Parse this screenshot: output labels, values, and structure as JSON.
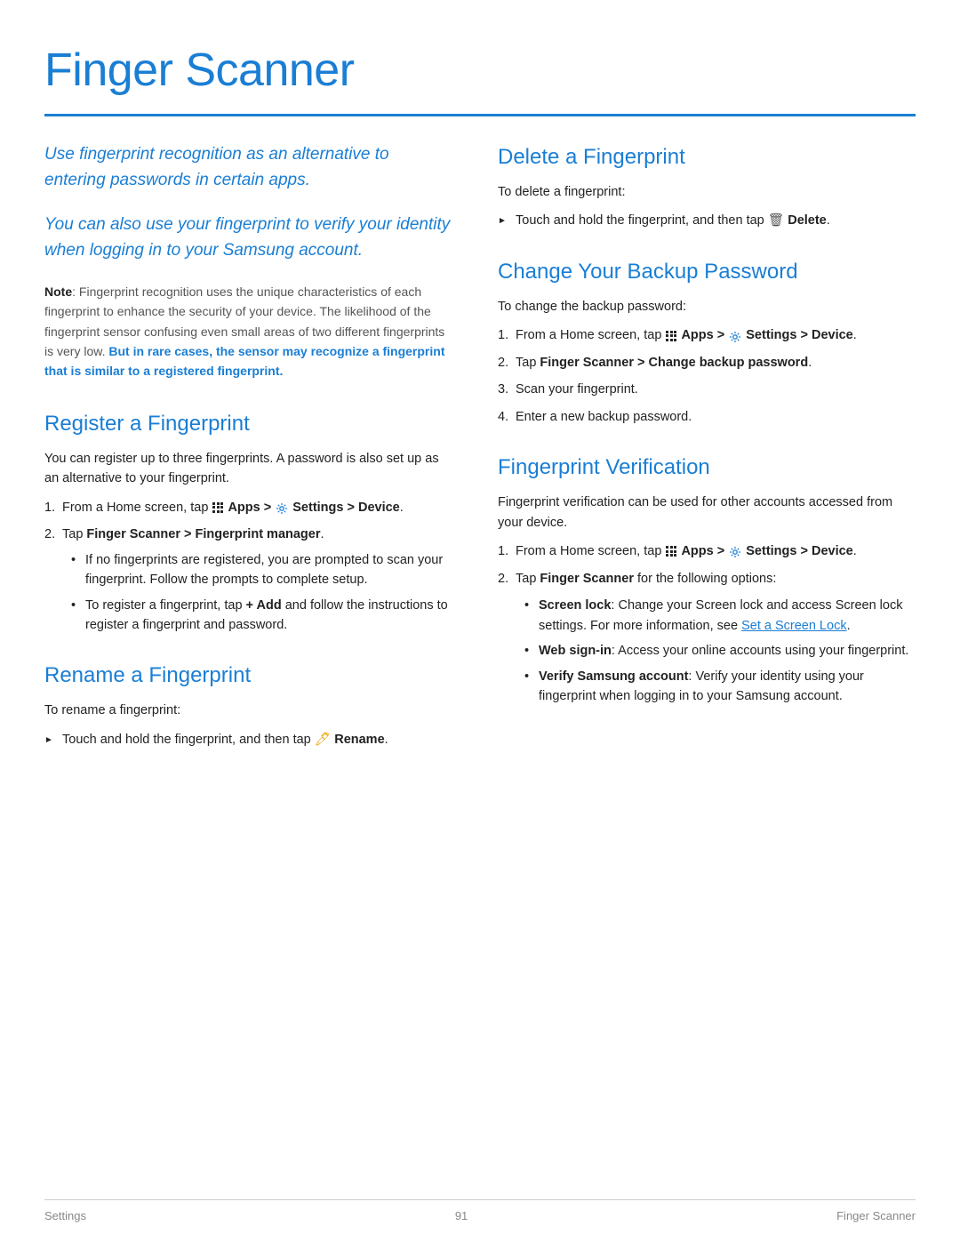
{
  "page": {
    "title": "Finger Scanner",
    "footer": {
      "left": "Settings",
      "center": "91",
      "right": "Finger Scanner"
    }
  },
  "intro": {
    "paragraph1": "Use fingerprint recognition as an alternative to entering passwords in certain apps.",
    "paragraph2": "You can also use your fingerprint to verify your identity when logging in to your Samsung account.",
    "note_label": "Note",
    "note_text": ": Fingerprint recognition uses the unique characteristics of each fingerprint to enhance the security of your device. The likelihood of the fingerprint sensor confusing even small areas of two different fingerprints is very low. ",
    "note_bold_blue": "But in rare cases, the sensor may recognize a fingerprint that is similar to a registered fingerprint."
  },
  "sections": {
    "register": {
      "title": "Register a Fingerprint",
      "intro": "You can register up to three fingerprints. A password is also set up as an alternative to your fingerprint.",
      "steps": [
        {
          "num": "1.",
          "text_parts": [
            "From a Home screen, tap ",
            "Apps > ",
            "Settings > Device",
            "."
          ]
        },
        {
          "num": "2.",
          "text_parts": [
            "Tap ",
            "Finger Scanner > Fingerprint manager",
            "."
          ]
        }
      ],
      "sub_bullets": [
        "If no fingerprints are registered, you are prompted to scan your fingerprint. Follow the prompts to complete setup.",
        "To register a fingerprint, tap  Add and follow the instructions to register a fingerprint and password."
      ]
    },
    "rename": {
      "title": "Rename a Fingerprint",
      "intro": "To rename a fingerprint:",
      "bullet": "Touch and hold the fingerprint, and then tap  Rename."
    },
    "delete": {
      "title": "Delete a Fingerprint",
      "intro": "To delete a fingerprint:",
      "bullet": "Touch and hold the fingerprint, and then tap  Delete."
    },
    "change_backup": {
      "title": "Change Your Backup Password",
      "intro": "To change the backup password:",
      "steps": [
        {
          "num": "1.",
          "text_parts": [
            "From a Home screen, tap ",
            "Apps > ",
            "Settings > Device",
            "."
          ]
        },
        {
          "num": "2.",
          "text_parts": [
            "Tap ",
            "Finger Scanner > Change backup password",
            "."
          ]
        },
        {
          "num": "3.",
          "text_parts": [
            "Scan your fingerprint."
          ]
        },
        {
          "num": "4.",
          "text_parts": [
            "Enter a new backup password."
          ]
        }
      ]
    },
    "verification": {
      "title": "Fingerprint Verification",
      "intro": "Fingerprint verification can be used for other accounts accessed from your device.",
      "steps": [
        {
          "num": "1.",
          "text_parts": [
            "From a Home screen, tap ",
            "Apps > ",
            "Settings > Device",
            "."
          ]
        },
        {
          "num": "2.",
          "text_parts": [
            "Tap ",
            "Finger Scanner",
            " for the following options:"
          ]
        }
      ],
      "sub_bullets": [
        {
          "label": "Screen lock",
          "text": ": Change your Screen lock and access Screen lock settings. For more information, see ",
          "link": "Set a Screen Lock",
          "end": "."
        },
        {
          "label": "Web sign-in",
          "text": ": Access your online accounts using your fingerprint.",
          "link": null,
          "end": ""
        },
        {
          "label": "Verify Samsung account",
          "text": ": Verify your identity using your fingerprint when logging in to your Samsung account.",
          "link": null,
          "end": ""
        }
      ]
    }
  }
}
